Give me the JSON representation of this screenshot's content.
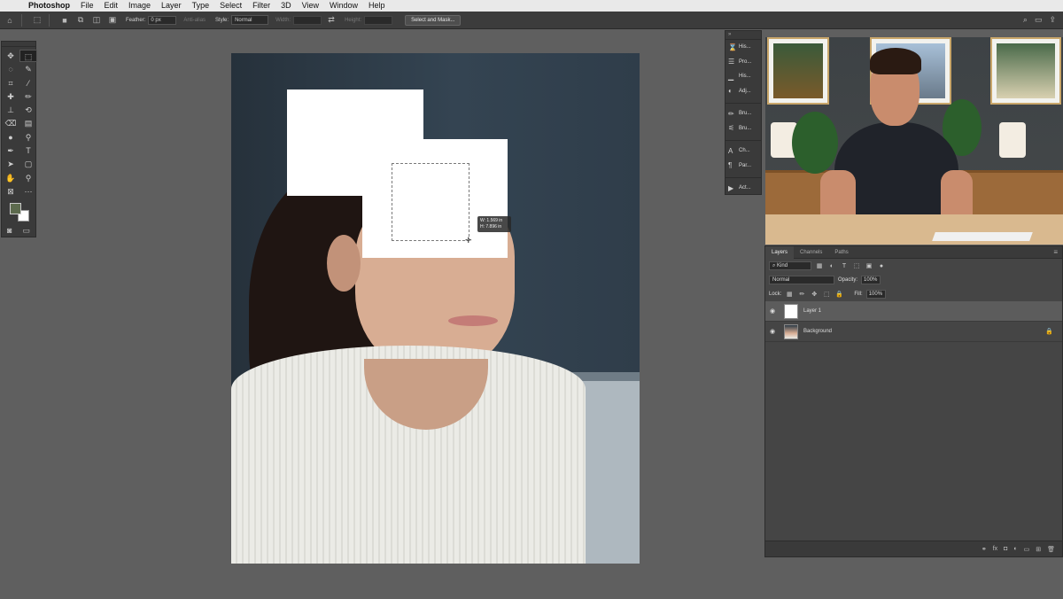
{
  "menubar": {
    "app": "Photoshop",
    "items": [
      "File",
      "Edit",
      "Image",
      "Layer",
      "Type",
      "Select",
      "Filter",
      "3D",
      "View",
      "Window",
      "Help"
    ]
  },
  "options": {
    "feather_label": "Feather:",
    "feather_value": "0 px",
    "antialias_label": "Anti-alias",
    "style_label": "Style:",
    "style_value": "Normal",
    "width_label": "Width:",
    "height_label": "Height:",
    "select_mask_label": "Select and Mask..."
  },
  "canvas": {
    "readout_w": "W: 1.569 in",
    "readout_h": "H: 7.896 in"
  },
  "panels": {
    "mini": [
      {
        "icon": "history-icon",
        "label": "His..."
      },
      {
        "icon": "properties-icon",
        "label": "Pro..."
      },
      {
        "icon": "histogram-icon",
        "label": "His..."
      },
      {
        "icon": "adjustments-icon",
        "label": "Adj..."
      },
      {
        "icon": "brush-icon",
        "label": "Bru..."
      },
      {
        "icon": "brush-settings-icon",
        "label": "Bru..."
      },
      {
        "icon": "character-icon",
        "label": "Ch..."
      },
      {
        "icon": "paragraph-icon",
        "label": "Par..."
      },
      {
        "icon": "actions-icon",
        "label": "Act..."
      }
    ]
  },
  "layers_panel": {
    "tabs": [
      "Layers",
      "Channels",
      "Paths"
    ],
    "active_tab": "Layers",
    "kind": "Kind",
    "blend_mode": "Normal",
    "opacity_label": "Opacity:",
    "opacity_value": "100%",
    "lock_label": "Lock:",
    "fill_label": "Fill:",
    "fill_value": "100%",
    "layers": [
      {
        "name": "Layer 1",
        "selected": true
      },
      {
        "name": "Background",
        "selected": false,
        "locked": true
      }
    ]
  },
  "colors": {
    "foreground": "#5d6b4e",
    "background": "#ffffff",
    "ui_dark": "#3a3a3a",
    "workspace": "#5f5f5f"
  }
}
